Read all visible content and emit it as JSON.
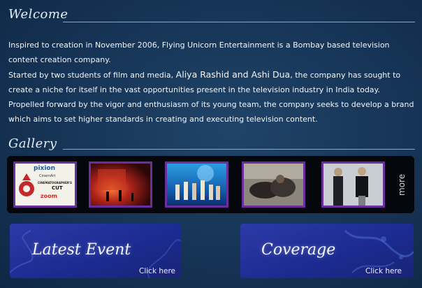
{
  "welcome": {
    "heading": "Welcome",
    "para1": "Inspired to creation in November 2006, Flying Unicorn Entertainment is a Bombay based television content creation company.",
    "para2_start": "Started by two students of film and media, ",
    "para2_names": "Aliya Rashid and Ashi Dua",
    "para2_end": ", the company has sought to create a niche for itself in the vast opportunities present in the television industry in India today.",
    "para3": "Propelled forward by the vigor and enthusiasm of its young team, the company seeks to develop a brand which aims to set higher standards in creating and executing television content."
  },
  "gallery": {
    "heading": "Gallery",
    "poster": {
      "line1": "pixion",
      "line2": "CinemArt",
      "line3": "CINEMATOGRAPHER'S",
      "line4": "CUT",
      "line5": "zoom"
    },
    "more_label": "more"
  },
  "panels": {
    "latest_event": {
      "title": "Latest Event",
      "link": "Click here"
    },
    "coverage": {
      "title": "Coverage",
      "link": "Click here"
    }
  },
  "colors": {
    "background": "#163456",
    "thumb_border": "#6a2f9d",
    "panel": "#1b2a8f"
  }
}
